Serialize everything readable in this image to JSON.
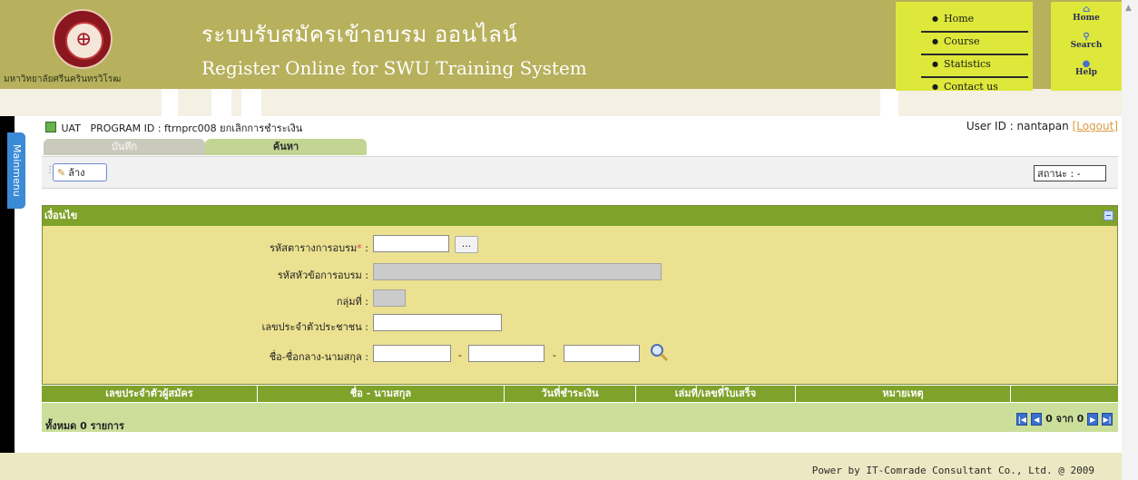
{
  "header": {
    "title_th": "ระบบรับสมัครเข้าอบรม ออนไลน์",
    "title_en": "Register Online for SWU Training System",
    "university_name": "มหาวิทยาลัยศรีนครินทรวิโรฒ",
    "logo_glyph": "⊕"
  },
  "nav": {
    "home": "Home",
    "course": "Course",
    "statistics": "Statistics",
    "contact": "Contact us"
  },
  "icons": {
    "home": "Home",
    "search": "Search",
    "help": "Help"
  },
  "side": {
    "mainmenu": "Mainmenu"
  },
  "program": {
    "env": "UAT",
    "label": "PROGRAM ID : ftrnprc008 ยกเลิกการชำระเงิน"
  },
  "user": {
    "label": "User ID : nantapan",
    "logout": "[Logout]"
  },
  "tabs": [
    "บันทึก",
    "ค้นหา"
  ],
  "toolbar": {
    "clear_label": "ล้าง",
    "status_label": "สถานะ : -"
  },
  "panel": {
    "title": "เงื่อนไข",
    "fields": {
      "schedule_code": "รหัสตารางการอบรม",
      "required_mark": "*",
      "topic_code": "รหัสหัวข้อการอบรม :",
      "group": "กลุ่มที่ :",
      "citizen_id": "เลขประจำตัวประชาชน :",
      "name": "ชื่อ-ชื่อกลาง-นามสกุล :"
    },
    "colon": " :",
    "browse": "...",
    "dash": "-"
  },
  "table": {
    "columns": [
      "เลขประจำตัวผู้สมัคร",
      "ชื่อ - นามสกุล",
      "วันที่ชำระเงิน",
      "เล่มที่/เลขที่ใบเสร็จ",
      "หมายเหตุ",
      ""
    ],
    "total": "ทั้งหมด  0  รายการ",
    "pager_text": "0 จาก 0"
  },
  "footer": {
    "powered": "Power by IT-Comrade Consultant Co., Ltd. @ 2009"
  }
}
